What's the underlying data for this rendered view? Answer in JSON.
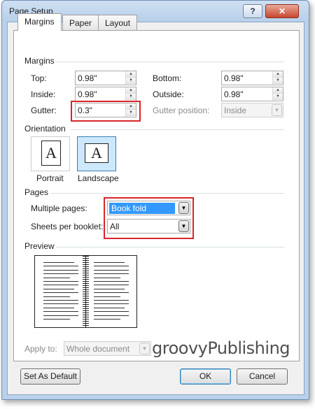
{
  "window": {
    "title": "Page Setup",
    "help_label": "?",
    "close_label": "✕"
  },
  "tabs": [
    {
      "label": "Margins",
      "active": true
    },
    {
      "label": "Paper",
      "active": false
    },
    {
      "label": "Layout",
      "active": false
    }
  ],
  "margins": {
    "section_title": "Margins",
    "top": {
      "label": "Top:",
      "value": "0.98\""
    },
    "bottom": {
      "label": "Bottom:",
      "value": "0.98\""
    },
    "inside": {
      "label": "Inside:",
      "value": "0.98\""
    },
    "outside": {
      "label": "Outside:",
      "value": "0.98\""
    },
    "gutter": {
      "label": "Gutter:",
      "value": "0.3\""
    },
    "gutter_position": {
      "label": "Gutter position:",
      "value": "Inside"
    }
  },
  "orientation": {
    "section_title": "Orientation",
    "portrait": {
      "label": "Portrait",
      "glyph": "A",
      "selected": false
    },
    "landscape": {
      "label": "Landscape",
      "glyph": "A",
      "selected": true
    }
  },
  "pages": {
    "section_title": "Pages",
    "multiple_pages": {
      "label": "Multiple pages:",
      "value": "Book fold"
    },
    "sheets_per_booklet": {
      "label": "Sheets per booklet:",
      "value": "All"
    }
  },
  "preview": {
    "section_title": "Preview"
  },
  "apply_to": {
    "label": "Apply to:",
    "value": "Whole document"
  },
  "buttons": {
    "set_default": "Set As Default",
    "ok": "OK",
    "cancel": "Cancel"
  },
  "watermark": "groovyPublishing",
  "colors": {
    "highlight": "#d8262b",
    "selection": "#3399ff",
    "dialog_frame": "#b9d1ea"
  }
}
